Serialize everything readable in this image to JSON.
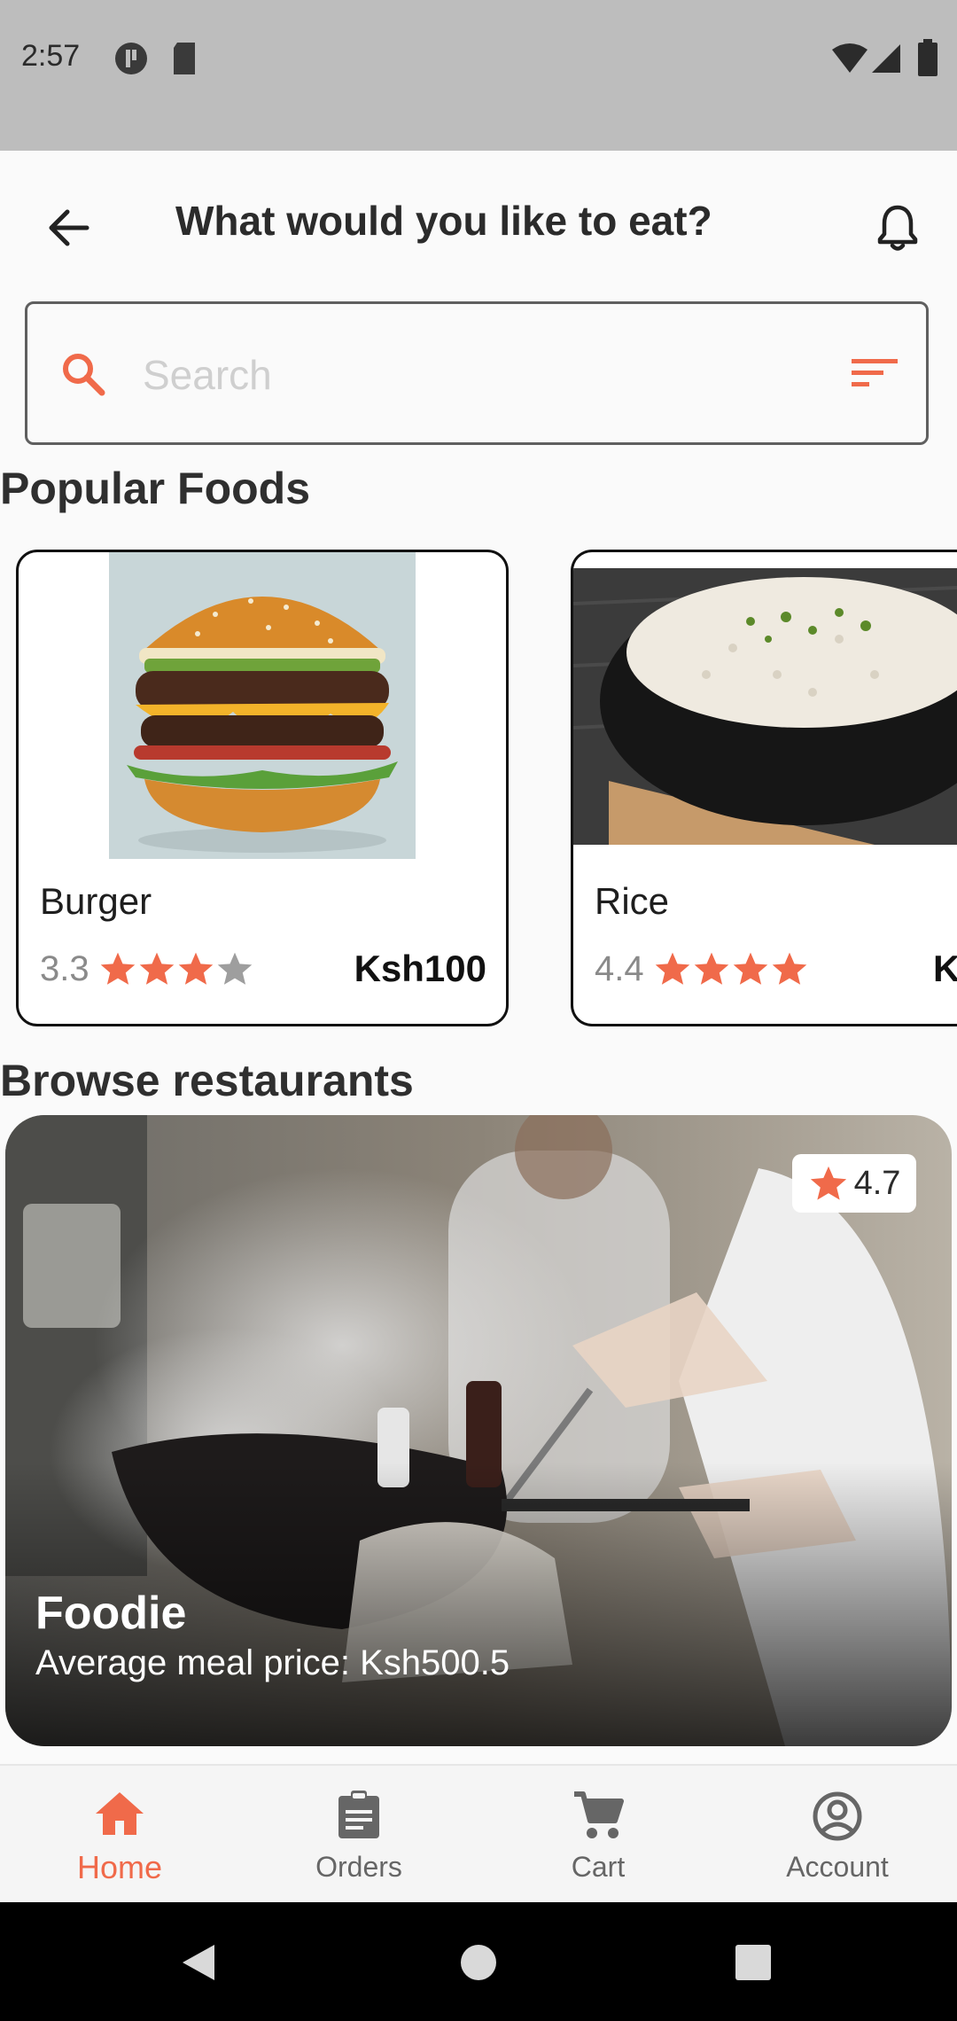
{
  "status_bar": {
    "time": "2:57"
  },
  "header": {
    "title": "What would you like to eat?"
  },
  "search": {
    "placeholder": "Search"
  },
  "sections": {
    "popular": "Popular Foods",
    "restaurants": "Browse restaurants"
  },
  "foods": [
    {
      "name": "Burger",
      "rating": "3.3",
      "stars_filled": 3,
      "price": "Ksh100"
    },
    {
      "name": "Rice",
      "rating": "4.4",
      "stars_filled": 4,
      "price": "Ksh"
    }
  ],
  "restaurant": {
    "name": "Foodie",
    "rating": "4.7",
    "price_label": "Average meal price: ",
    "price_value": "Ksh500.5"
  },
  "nav": [
    {
      "label": "Home",
      "icon": "home-icon",
      "active": true
    },
    {
      "label": "Orders",
      "icon": "clipboard-icon",
      "active": false
    },
    {
      "label": "Cart",
      "icon": "cart-icon",
      "active": false
    },
    {
      "label": "Account",
      "icon": "account-icon",
      "active": false
    }
  ],
  "colors": {
    "accent": "#f06a4a",
    "star_filled": "#f06a4a",
    "star_empty": "#9e9e9e"
  }
}
